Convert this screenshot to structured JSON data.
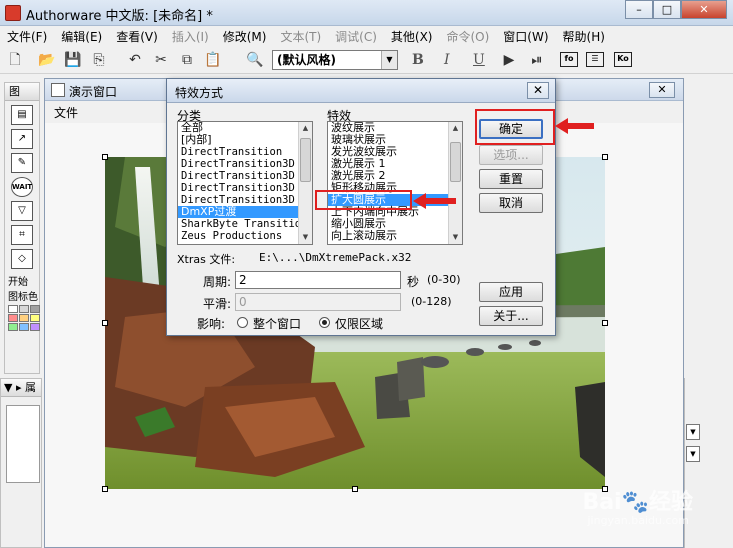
{
  "window": {
    "title": "Authorware 中文版: [未命名] *",
    "min_label": "–",
    "max_label": "□",
    "close_label": "✕"
  },
  "menubar": {
    "items": [
      {
        "label": "文件(F)",
        "enabled": true
      },
      {
        "label": "编辑(E)",
        "enabled": true
      },
      {
        "label": "查看(V)",
        "enabled": true
      },
      {
        "label": "插入(I)",
        "enabled": false
      },
      {
        "label": "修改(M)",
        "enabled": true
      },
      {
        "label": "文本(T)",
        "enabled": false
      },
      {
        "label": "调试(C)",
        "enabled": false
      },
      {
        "label": "其他(X)",
        "enabled": true
      },
      {
        "label": "命令(O)",
        "enabled": false
      },
      {
        "label": "窗口(W)",
        "enabled": true
      },
      {
        "label": "帮助(H)",
        "enabled": true
      }
    ]
  },
  "toolbar": {
    "style_value": "(默认风格)",
    "bold": "B",
    "italic": "I",
    "underline": "U",
    "box1": "fo",
    "box3": "Ko"
  },
  "palette": {
    "header": "图",
    "start_label": "开始",
    "swatch_label": "图标色",
    "wait_label": "WAIT",
    "swatch_colors": [
      "#ffffff",
      "#d8d8d8",
      "#a0a0a0",
      "#ff8c8c",
      "#ffd080",
      "#ffff80",
      "#90ee90",
      "#80c0ff",
      "#c090ff"
    ]
  },
  "props_panel": {
    "header": "属"
  },
  "presentation": {
    "title": "演示窗口",
    "menu_file": "文件",
    "close_label": "✕"
  },
  "dialog": {
    "title": "特效方式",
    "close_label": "✕",
    "category_label": "分类",
    "effect_label": "特效",
    "categories": [
      {
        "text": "全部",
        "cn": true,
        "selected": false
      },
      {
        "text": "[内部]",
        "cn": true,
        "selected": false
      },
      {
        "text": "DirectTransition",
        "cn": false,
        "selected": false
      },
      {
        "text": "DirectTransition3D",
        "cn": false,
        "selected": false
      },
      {
        "text": "DirectTransition3D :",
        "cn": false,
        "selected": false
      },
      {
        "text": "DirectTransition3D :",
        "cn": false,
        "selected": false
      },
      {
        "text": "DirectTransition3D :",
        "cn": false,
        "selected": false
      },
      {
        "text": "DmXP过渡",
        "cn": true,
        "selected": true
      },
      {
        "text": "SharkByte Transitio",
        "cn": false,
        "selected": false
      },
      {
        "text": "Zeus Productions",
        "cn": false,
        "selected": false
      }
    ],
    "effects": [
      {
        "text": "波纹展示",
        "selected": false
      },
      {
        "text": "玻璃状展示",
        "selected": false
      },
      {
        "text": "发光波纹展示",
        "selected": false
      },
      {
        "text": "激光展示 1",
        "selected": false
      },
      {
        "text": "激光展示 2",
        "selected": false
      },
      {
        "text": "矩形移动展示",
        "selected": false
      },
      {
        "text": "扩大圆展示",
        "selected": true
      },
      {
        "text": "上下内端向中展示",
        "selected": false
      },
      {
        "text": "缩小圆展示",
        "selected": false
      },
      {
        "text": "向上滚动展示",
        "selected": false
      }
    ],
    "xtras_label": "Xtras 文件:",
    "xtras_path": "E:\\...\\DmXtremePack.x32",
    "period_label": "周期:",
    "period_value": "2",
    "period_unit": "秒",
    "period_range": "(0-30)",
    "smooth_label": "平滑:",
    "smooth_value": "0",
    "smooth_range": "(0-128)",
    "affect_label": "影响:",
    "affect_whole": "整个窗口",
    "affect_area": "仅限区域",
    "affect_selected": "area",
    "btn_ok": "确定",
    "btn_options": "选项...",
    "btn_reset": "重置",
    "btn_cancel": "取消",
    "btn_apply": "应用",
    "btn_about": "关于..."
  },
  "watermark": {
    "main": "Bai🐾经验",
    "sub": "jingyan.baidu.com"
  },
  "annotation_color": "#e02020"
}
